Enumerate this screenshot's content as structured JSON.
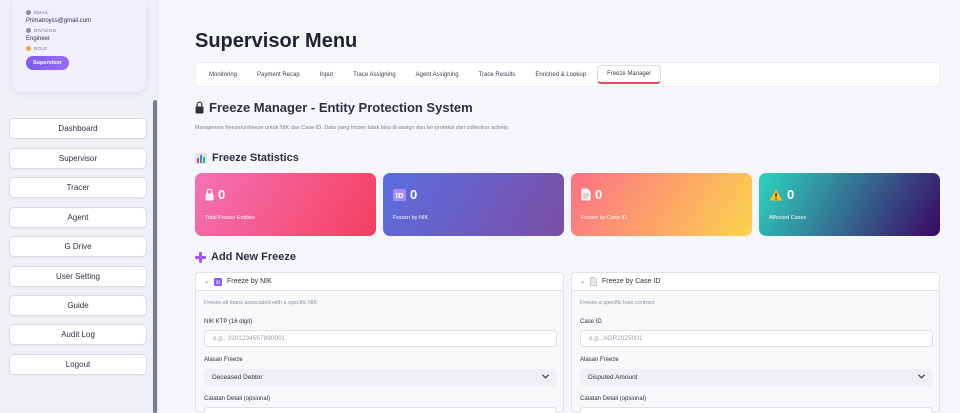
{
  "user": {
    "email_label": "EMAIL",
    "email": "Primatroyss@gmail.com",
    "division_label": "DIVISION",
    "division": "Engineer",
    "role_label": "ROLE",
    "role": "Supervisor"
  },
  "nav": [
    "Dashboard",
    "Supervisor",
    "Tracer",
    "Agent",
    "G Drive",
    "User Setting",
    "Guide",
    "Audit Log",
    "Logout"
  ],
  "page_title": "Supervisor Menu",
  "tabs": [
    "Monitoring",
    "Payment Recap",
    "Input",
    "Trace Assigning",
    "Agent Assigning",
    "Trace Results",
    "Enriched & Lookup",
    "Freeze Manager"
  ],
  "active_tab": "Freeze Manager",
  "freeze": {
    "title": "Freeze Manager - Entity Protection System",
    "description": "Manajemen freeze/unfreeze untuk NIK dan Case ID. Data yang frozen tidak bisa di-assign dan ter-proteksi dari collection activity.",
    "stats_title": "Freeze Statistics",
    "stats": [
      {
        "value": "0",
        "label": "Total Frozen Entities",
        "icon": "lock-icon",
        "color_from": "#f472b6",
        "color_to": "#f43f5e"
      },
      {
        "value": "0",
        "label": "Frozen by NIK",
        "icon": "id-icon",
        "color_from": "#5b6ee1",
        "color_to": "#7b4ea5"
      },
      {
        "value": "0",
        "label": "Frozen by Case ID",
        "icon": "document-icon",
        "color_from": "#fb7185",
        "color_to": "#fcd34d"
      },
      {
        "value": "0",
        "label": "Affected Cases",
        "icon": "warning-icon",
        "color_from": "#2dd4bf",
        "color_to": "#3b0764"
      }
    ],
    "add_title": "Add New Freeze",
    "nik_panel": {
      "title": "Freeze by NIK",
      "description": "Freeze all loans associated with a specific NIK",
      "field_label": "NIK KTP (16 digit)",
      "placeholder": "e.g., 3201234567890001",
      "reason_label": "Alasan Freeze",
      "reason_value": "Deceased Debtor",
      "detail_label": "Catatan Detail (opsional)"
    },
    "case_panel": {
      "title": "Freeze by Case ID",
      "description": "Freeze a specific loan contract",
      "field_label": "Case ID",
      "placeholder": "e.g., AGR2025001",
      "reason_label": "Alasan Freeze",
      "reason_value": "Disputed Amount",
      "detail_label": "Catatan Detail (opsional)"
    }
  }
}
